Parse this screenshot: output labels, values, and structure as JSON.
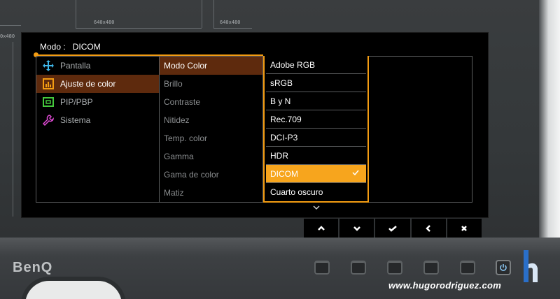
{
  "background": {
    "resolution_labels": [
      "640x480",
      "640x480",
      "0x480"
    ]
  },
  "osd": {
    "mode_label": "Modo :",
    "mode_value": "DICOM",
    "main_menu": [
      {
        "label": "Pantalla",
        "icon": "display-adjust-icon",
        "icon_color": "#3fb6e8"
      },
      {
        "label": "Ajuste de color",
        "icon": "color-adjust-icon",
        "icon_color": "#f39c12"
      },
      {
        "label": "PIP/PBP",
        "icon": "pip-pbp-icon",
        "icon_color": "#45c93d"
      },
      {
        "label": "Sistema",
        "icon": "wrench-icon",
        "icon_color": "#e04bd6"
      }
    ],
    "submenu": [
      "Modo Color",
      "Brillo",
      "Contraste",
      "Nitidez",
      "Temp. color",
      "Gamma",
      "Gama de color",
      "Matiz"
    ],
    "options": [
      "Adobe RGB",
      "sRGB",
      "B y N",
      "Rec.709",
      "DCI-P3",
      "HDR",
      "DICOM",
      "Cuarto oscuro"
    ],
    "selected_option": "DICOM"
  },
  "keyguide": [
    "chevron-up-icon",
    "chevron-down-icon",
    "check-icon",
    "chevron-left-icon",
    "close-icon"
  ],
  "monitor": {
    "brand": "BenQ"
  },
  "watermark": "www.hugorodriguez.com",
  "colors": {
    "accent": "#f39c12",
    "active_bg": "#5e2a0d",
    "selected_bg": "#f7a51d"
  }
}
